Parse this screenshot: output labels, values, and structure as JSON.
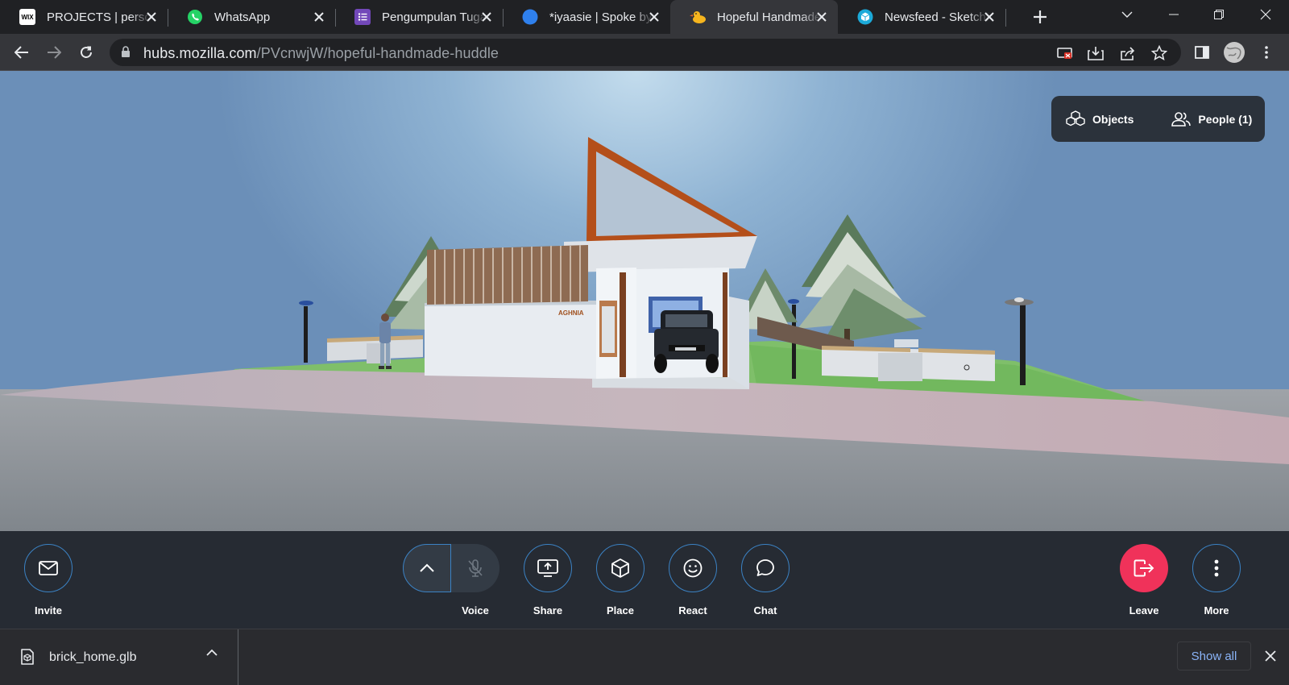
{
  "browser": {
    "tabs": [
      {
        "title": "PROJECTS | personal",
        "favicon": "wix-icon",
        "favicon_text": "WIX",
        "favicon_color": "#ffffff",
        "active": false
      },
      {
        "title": "WhatsApp",
        "favicon": "whatsapp-icon",
        "favicon_color": "#25d366",
        "active": false
      },
      {
        "title": "Pengumpulan Tugas",
        "favicon": "google-forms-icon",
        "favicon_color": "#7248b9",
        "active": false
      },
      {
        "title": "*iyaasie | Spoke by Mozilla",
        "favicon": "spoke-icon",
        "favicon_color": "#2f80ed",
        "active": false
      },
      {
        "title": "Hopeful Handmade Huddle",
        "favicon": "hubs-duck-icon",
        "favicon_color": "#f6b51e",
        "active": true
      },
      {
        "title": "Newsfeed - Sketchfab",
        "favicon": "sketchfab-icon",
        "favicon_color": "#1caad9",
        "active": false
      }
    ],
    "url_host": "hubs.mozilla.com",
    "url_path": "/PVcnwjW/hopeful-handmade-huddle"
  },
  "scene": {
    "house_sign": "AGHNIA",
    "top_panel": {
      "objects_label": "Objects",
      "people_label": "People (1)"
    }
  },
  "toolbar": {
    "invite_label": "Invite",
    "voice_label": "Voice",
    "share_label": "Share",
    "place_label": "Place",
    "react_label": "React",
    "chat_label": "Chat",
    "leave_label": "Leave",
    "more_label": "More"
  },
  "downloads": {
    "filename": "brick_home.glb",
    "show_all_label": "Show all"
  },
  "colors": {
    "leave": "#f0325a",
    "accent_outline": "#3b82c4",
    "link": "#8ab4f8"
  }
}
